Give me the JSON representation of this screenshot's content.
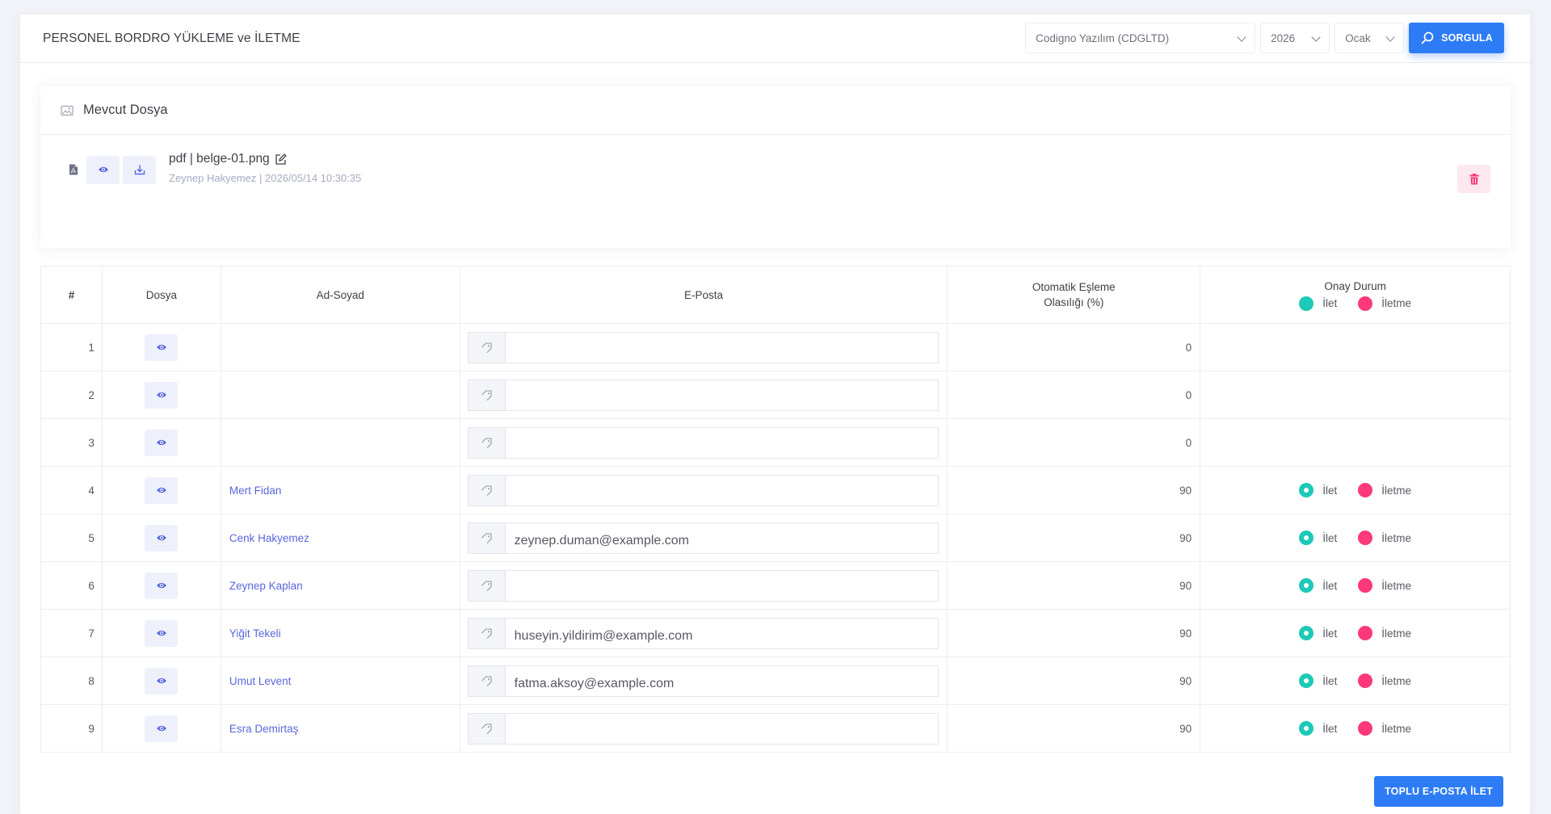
{
  "header": {
    "title": "PERSONEL BORDRO YÜKLEME ve İLETME",
    "company_select": "Codigno Yazılım (CDGLTD)",
    "year_select": "2026",
    "month_select": "Ocak",
    "query_button": "SORGULA"
  },
  "file_section": {
    "title": "Mevcut Dosya",
    "file_name": "pdf | belge-01.png",
    "file_meta": "Zeynep Hakyemez | 2026/05/14 10:30:35"
  },
  "table": {
    "headers": {
      "index": "#",
      "file": "Dosya",
      "name": "Ad-Soyad",
      "email": "E-Posta",
      "match_line1": "Otomatik Eşleme",
      "match_line2": "Olasılığı (%)",
      "status": "Onay Durum",
      "status_send": "İlet",
      "status_nosend": "İletme"
    },
    "rows": [
      {
        "index": "1",
        "name": "",
        "email": "",
        "score": "0",
        "status": false
      },
      {
        "index": "2",
        "name": "",
        "email": "",
        "score": "0",
        "status": false
      },
      {
        "index": "3",
        "name": "",
        "email": "",
        "score": "0",
        "status": false
      },
      {
        "index": "4",
        "name": "Mert Fidan",
        "email": "",
        "score": "90",
        "status": true
      },
      {
        "index": "5",
        "name": "Cenk Hakyemez",
        "email": "zeynep.duman@example.com",
        "score": "90",
        "status": true
      },
      {
        "index": "6",
        "name": "Zeynep Kaplan",
        "email": "",
        "score": "90",
        "status": true
      },
      {
        "index": "7",
        "name": "Yiğit Tekeli",
        "email": "huseyin.yildirim@example.com",
        "score": "90",
        "status": true
      },
      {
        "index": "8",
        "name": "Umut Levent",
        "email": "fatma.aksoy@example.com",
        "score": "90",
        "status": true
      },
      {
        "index": "9",
        "name": "Esra Demirtaş",
        "email": "",
        "score": "90",
        "status": true
      }
    ],
    "row_status_send": "İlet",
    "row_status_nosend": "İletme"
  },
  "footer": {
    "bulk_send_button": "TOPLU E-POSTA İLET"
  },
  "colors": {
    "primary": "#2d7cf6",
    "link": "#5867dd",
    "send": "#1dc9b7",
    "nosend": "#fd397a"
  }
}
